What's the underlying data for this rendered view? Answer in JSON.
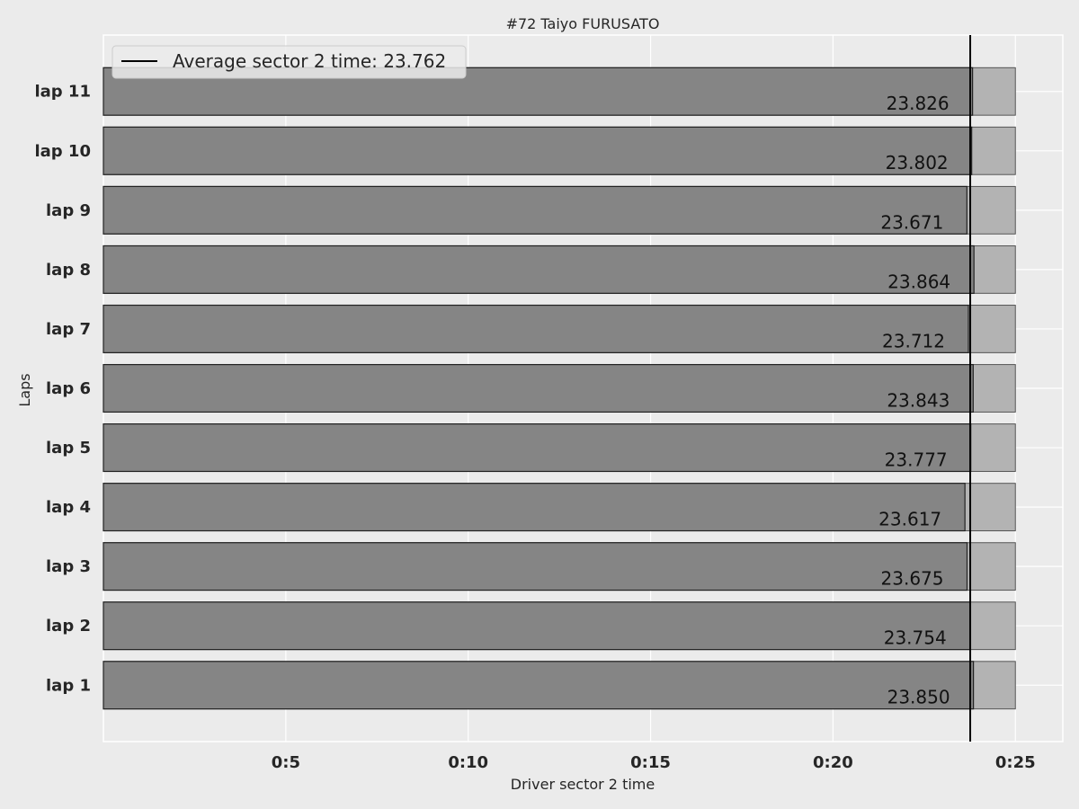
{
  "chart_data": {
    "type": "bar",
    "orientation": "horizontal",
    "title": "#72  Taiyo FURUSATO",
    "xlabel": "Driver sector 2 time",
    "ylabel": "Laps",
    "categories": [
      "lap 1",
      "lap 2",
      "lap 3",
      "lap 4",
      "lap 5",
      "lap 6",
      "lap 7",
      "lap 8",
      "lap 9",
      "lap 10",
      "lap 11"
    ],
    "values": [
      23.85,
      23.754,
      23.675,
      23.617,
      23.777,
      23.843,
      23.712,
      23.864,
      23.671,
      23.802,
      23.826
    ],
    "value_labels": [
      "23.850",
      "23.754",
      "23.675",
      "23.617",
      "23.777",
      "23.843",
      "23.712",
      "23.864",
      "23.671",
      "23.802",
      "23.826"
    ],
    "background_bar_value": 25,
    "reference_line": {
      "value": 23.762,
      "label": "Average sector 2 time: 23.762"
    },
    "xlim": [
      0,
      26.3
    ],
    "xticks": [
      5,
      10,
      15,
      20,
      25
    ],
    "xtick_labels": [
      "0:5",
      "0:10",
      "0:15",
      "0:20",
      "0:25"
    ],
    "grid": true,
    "legend_position": "upper-left",
    "colors": {
      "background": "#ebebeb",
      "plot_background": "#ebebeb",
      "grid": "#ffffff",
      "bar": "#808080",
      "background_bar": "#b3b3b3",
      "bar_edge": "#222222",
      "reference_line": "#000000"
    }
  }
}
